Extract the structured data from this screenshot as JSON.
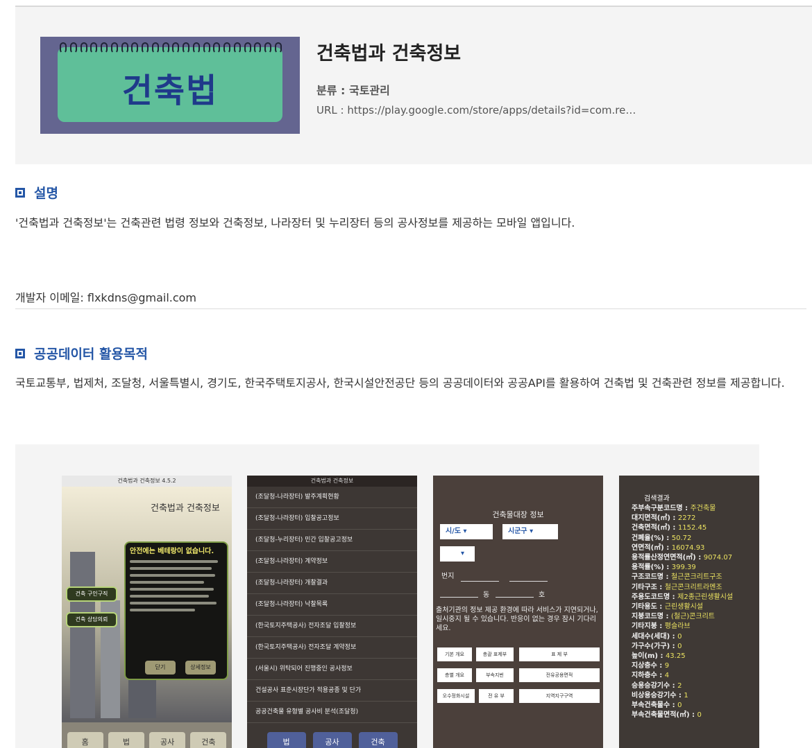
{
  "app": {
    "icon_text": "건축법",
    "title": "건축법과 건축정보",
    "category_label": "분류 : ",
    "category": "국토관리",
    "url_label": "URL : ",
    "url": "https://play.google.com/store/apps/details?id=com.re…"
  },
  "sections": {
    "description": {
      "heading": "설명",
      "text": "'건축법과 건축정보'는 건축관련 법령 정보와 건축정보, 나라장터 및 누리장터 등의 공사정보를 제공하는 모바일 앱입니다.",
      "email": "개발자 이메일: flxkdns@gmail.com"
    },
    "purpose": {
      "heading": "공공데이터 활용목적",
      "text": "국토교통부, 법제처, 조달청, 서울특별시, 경기도, 한국주택토지공사, 한국시설안전공단 등의 공공데이터와 공공API를 활용하여 건축법 및 건축관련 정보를 제공합니다."
    }
  },
  "screenshots": {
    "s1": {
      "bar": "건축법과 건축정보 4.5.2",
      "title": "건축법과 건축정보",
      "side_btn_1": "건축 구인구직",
      "side_btn_2": "건축 상담의뢰",
      "popup_title": "안전에는 베테랑이 없습니다.",
      "popup_btn_close": "닫기",
      "popup_btn_detail": "상세정보",
      "nav": [
        "홈",
        "법",
        "공사",
        "건축"
      ]
    },
    "s2": {
      "bar": "건축법과 건축정보",
      "items": [
        "(조달청-나라장터) 발주계획현황",
        "(조달청-나라장터) 입찰공고정보",
        "(조달청-누리장터) 민간 입찰공고정보",
        "(조달청-나라장터) 계약정보",
        "(조달청-나라장터) 개찰결과",
        "(조달청-나라장터) 낙찰목록",
        "(한국토지주택공사) 전자조달 입찰정보",
        "(한국토지주택공사) 전자조달 계약정보",
        "(서울시) 위탁되어 진행중인 공사정보",
        "건설공사 표준시장단가 적용공종 및 단가",
        "공공건축물 유형별 공사비 분석(조달청)"
      ],
      "nav": [
        "법",
        "공사",
        "건축"
      ]
    },
    "s3": {
      "heading": "건축물대장 정보",
      "sel_sido": "시/도",
      "sel_sigungu": "시군구",
      "beonji": "번지",
      "dong": "동",
      "ho": "호",
      "note": "출처기관의 정보 제공 환경에 따라 서비스가 지연되거나, 일시중지 될 수 있습니다. 반응이 없는 경우 잠시 기다리세요.",
      "buttons": [
        "기본 개요",
        "총괄 표제부",
        "표 제 부",
        "층별 개요",
        "부속지번",
        "전유공용면적",
        "오수정화시설",
        "전 유 부",
        "지역지구구역"
      ]
    },
    "s4": {
      "heading": "검색결과",
      "rows": [
        [
          "주부속구분코드명 : ",
          "주건축물"
        ],
        [
          "대지면적(㎡) : ",
          "2272"
        ],
        [
          "건축면적(㎡) : ",
          "1152.45"
        ],
        [
          "건폐율(%) : ",
          "50.72"
        ],
        [
          "연면적(㎡) : ",
          "16074.93"
        ],
        [
          "용적률산정연면적(㎡) : ",
          "9074.07"
        ],
        [
          "용적률(%) : ",
          "399.39"
        ],
        [
          "구조코드명 : ",
          "철근콘크리트구조"
        ],
        [
          "기타구조 : ",
          "철근콘크리트라멘조"
        ],
        [
          "주용도코드명 : ",
          "제2종근린생활시설"
        ],
        [
          "기타용도 : ",
          "근린생활시설"
        ],
        [
          "지붕코드명 : ",
          "(철근)콘크리트"
        ],
        [
          "기타지붕 : ",
          "평슬라브"
        ],
        [
          "세대수(세대) : ",
          "0"
        ],
        [
          "가구수(가구) : ",
          "0"
        ],
        [
          "높이(m) : ",
          "43.25"
        ],
        [
          "지상층수 : ",
          "9"
        ],
        [
          "지하층수 : ",
          "4"
        ],
        [
          "승용승강기수 : ",
          "2"
        ],
        [
          "비상용승강기수 : ",
          "1"
        ],
        [
          "부속건축물수 : ",
          "0"
        ],
        [
          "부속건축물면적(㎡) : ",
          "0"
        ]
      ]
    }
  }
}
